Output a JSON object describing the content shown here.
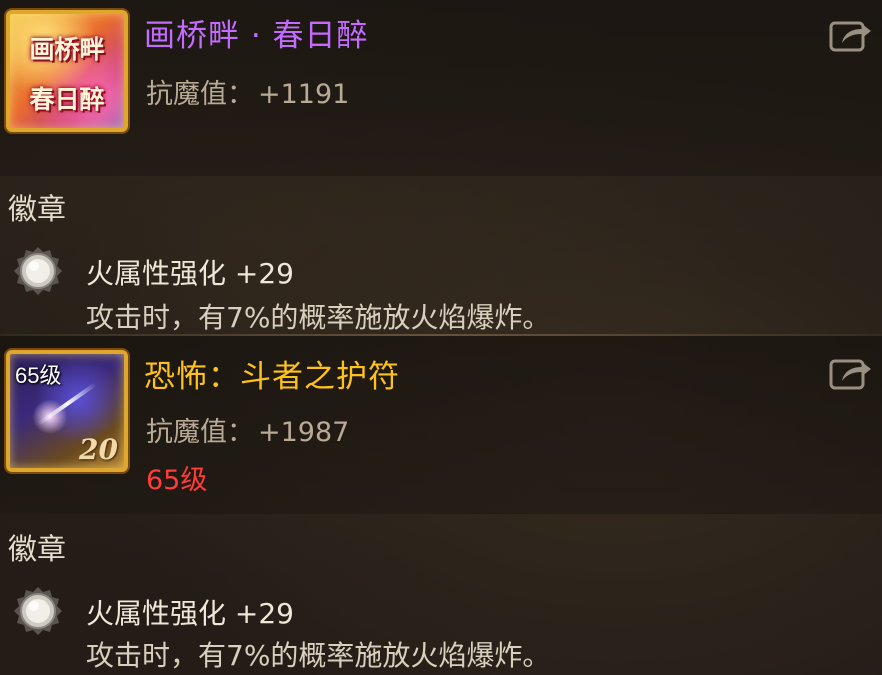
{
  "items": [
    {
      "name": "画桥畔 · 春日醉",
      "name_color": "#c36bff",
      "icon": "spring-scroll-icon",
      "icon_text_line1": "画桥畔",
      "icon_text_line2": "春日醉",
      "stat_label": "抗魔值：",
      "stat_value": "+1191",
      "section_title": "徽章",
      "medal_icon": "silver-medal-icon",
      "medal_name": "火属性强化 +29",
      "medal_desc": "攻击时，有7%的概率施放火焰爆炸。"
    },
    {
      "name": "恐怖：斗者之护符",
      "name_color": "#ffc21a",
      "icon": "amulet-icon",
      "icon_level": "65级",
      "icon_number": "20",
      "stat_label": "抗魔值：",
      "stat_value": "+1987",
      "level_requirement": "65级",
      "level_color": "#ff3b3b",
      "section_title": "徽章",
      "medal_icon": "silver-medal-icon",
      "medal_name": "火属性强化 +29",
      "medal_desc": "攻击时，有7%的概率施放火焰爆炸。"
    }
  ],
  "share_icon": "share-icon"
}
